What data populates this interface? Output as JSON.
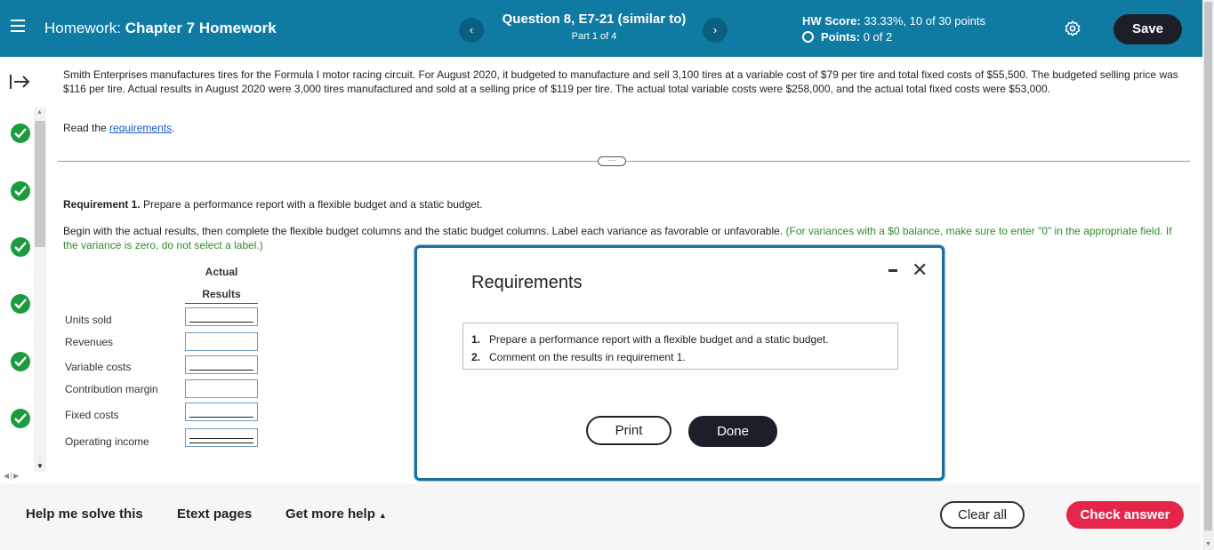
{
  "header": {
    "title_prefix": "Homework:",
    "title": "Chapter 7 Homework",
    "question_title": "Question 8, E7-21 (similar to)",
    "question_part": "Part 1 of 4",
    "prev_icon": "chevron-left-icon",
    "next_icon": "chevron-right-icon",
    "hw_score_label": "HW Score:",
    "hw_score_value": "33.33%, 10 of 30 points",
    "points_label": "Points:",
    "points_value": "0 of 2",
    "save_label": "Save",
    "accent_color": "#0f7ba3"
  },
  "problem": {
    "text": "Smith Enterprises manufactures tires for the Formula I motor racing circuit. For August 2020, it budgeted to manufacture and sell 3,100 tires at a variable cost of $79 per tire and total fixed costs of $55,500. The budgeted selling price was $116 per tire. Actual results in August 2020 were 3,000 tires manufactured and sold at a selling price of $119 per tire. The actual total variable costs were $258,000, and the actual total fixed costs were $53,000.",
    "read_prefix": "Read the",
    "read_link": "requirements",
    "read_suffix": "."
  },
  "requirement": {
    "label": "Requirement 1.",
    "text": " Prepare a performance report with a flexible budget and a static budget.",
    "instruction": "Begin with the actual results, then complete the flexible budget columns and the static budget columns. Label each variance as favorable or unfavorable.",
    "instruction_note": "(For variances with a $0 balance, make sure to enter \"0\" in the appropriate field. If the variance is zero, do not select a label.)"
  },
  "table": {
    "column_header_1": "Actual",
    "column_header_2": "Results",
    "rows": [
      "Units sold",
      "Revenues",
      "Variable costs",
      "Contribution margin",
      "Fixed costs",
      "Operating income"
    ]
  },
  "modal": {
    "title": "Requirements",
    "items": [
      {
        "num": "1.",
        "text": "Prepare a performance report with a flexible budget and a static budget."
      },
      {
        "num": "2.",
        "text": "Comment on the results in requirement 1."
      }
    ],
    "print_label": "Print",
    "done_label": "Done"
  },
  "footer": {
    "help_label": "Help me solve this",
    "etext_label": "Etext pages",
    "more_help_label": "Get more help",
    "clear_label": "Clear all",
    "check_label": "Check answer",
    "check_color": "#e5254a"
  }
}
